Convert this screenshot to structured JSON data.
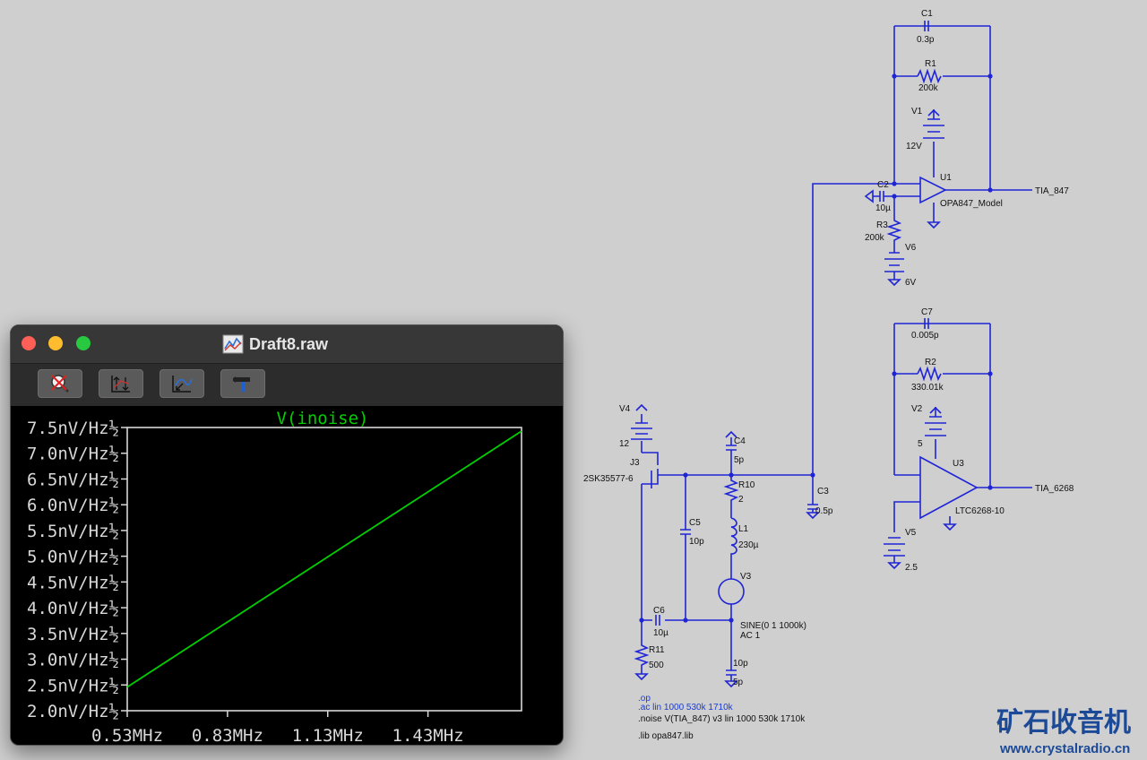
{
  "window": {
    "title": "Draft8.raw",
    "toolbar_buttons": [
      "zoom-cancel-icon",
      "autorange-icon",
      "pan-icon",
      "settings-hammer-icon"
    ]
  },
  "plot": {
    "trace_name": "V(inoise)",
    "trace_color": "#00d000",
    "y_tick_labels": [
      "7.5nV/Hz½",
      "7.0nV/Hz½",
      "6.5nV/Hz½",
      "6.0nV/Hz½",
      "5.5nV/Hz½",
      "5.0nV/Hz½",
      "4.5nV/Hz½",
      "4.0nV/Hz½",
      "3.5nV/Hz½",
      "3.0nV/Hz½",
      "2.5nV/Hz½",
      "2.0nV/Hz½"
    ],
    "x_tick_labels": [
      "0.53MHz",
      "0.83MHz",
      "1.13MHz",
      "1.43MHz"
    ]
  },
  "chart_data": {
    "type": "line",
    "title": "V(inoise)",
    "series": [
      {
        "name": "V(inoise)",
        "x": [
          0.53,
          1.71
        ],
        "y": [
          2.46,
          7.43
        ]
      }
    ],
    "xlim": [
      0.53,
      1.71
    ],
    "ylim": [
      2.0,
      7.5
    ],
    "x_ticks": [
      0.53,
      0.83,
      1.13,
      1.43
    ],
    "y_ticks": [
      7.5,
      7.0,
      6.5,
      6.0,
      5.5,
      5.0,
      4.5,
      4.0,
      3.5,
      3.0,
      2.5,
      2.0
    ],
    "grid": false
  },
  "schematic": {
    "components": {
      "c1": {
        "name": "C1",
        "value": "0.3p"
      },
      "r1": {
        "name": "R1",
        "value": "200k"
      },
      "v1": {
        "name": "V1",
        "value": "12V"
      },
      "u1": {
        "name": "U1",
        "value": "OPA847_Model"
      },
      "c2": {
        "name": "C2",
        "value": "10µ"
      },
      "r3": {
        "name": "R3",
        "value": "200k"
      },
      "v6": {
        "name": "V6",
        "value": "6V"
      },
      "c7": {
        "name": "C7",
        "value": "0.005p"
      },
      "r2": {
        "name": "R2",
        "value": "330.01k"
      },
      "v2": {
        "name": "V2",
        "value": "5"
      },
      "u3": {
        "name": "U3",
        "value": "LTC6268-10"
      },
      "v5": {
        "name": "V5",
        "value": "2.5"
      },
      "v4": {
        "name": "V4",
        "value": "12"
      },
      "j3": {
        "name": "J3",
        "value": "2SK35577-6"
      },
      "c4": {
        "name": "C4",
        "value": "5p"
      },
      "r10": {
        "name": "R10",
        "value": "2"
      },
      "c3": {
        "name": "C3",
        "value": "0.5p"
      },
      "c5": {
        "name": "C5",
        "value": "10p"
      },
      "l1": {
        "name": "L1",
        "value": "230µ"
      },
      "v3": {
        "name": "V3",
        "value": "SINE(0 1 1000k)",
        "value2": "AC 1"
      },
      "c6": {
        "name": "C6",
        "value": "10µ"
      },
      "r11": {
        "name": "R11",
        "value": "500"
      },
      "c_bottom": {
        "value": "10p"
      },
      "c_bottom2": {
        "value": "5p"
      }
    },
    "net_labels": {
      "tia847": "TIA_847",
      "tia6268": "TIA_6268"
    },
    "directives": [
      ".op",
      ".ac lin 1000 530k 1710k",
      ".noise V(TIA_847) v3 lin 1000 530k 1710k",
      ".lib opa847.lib"
    ],
    "wire_color": "#1f25d6"
  },
  "watermark": {
    "cn": "矿石收音机",
    "url": "www.crystalradio.cn"
  }
}
